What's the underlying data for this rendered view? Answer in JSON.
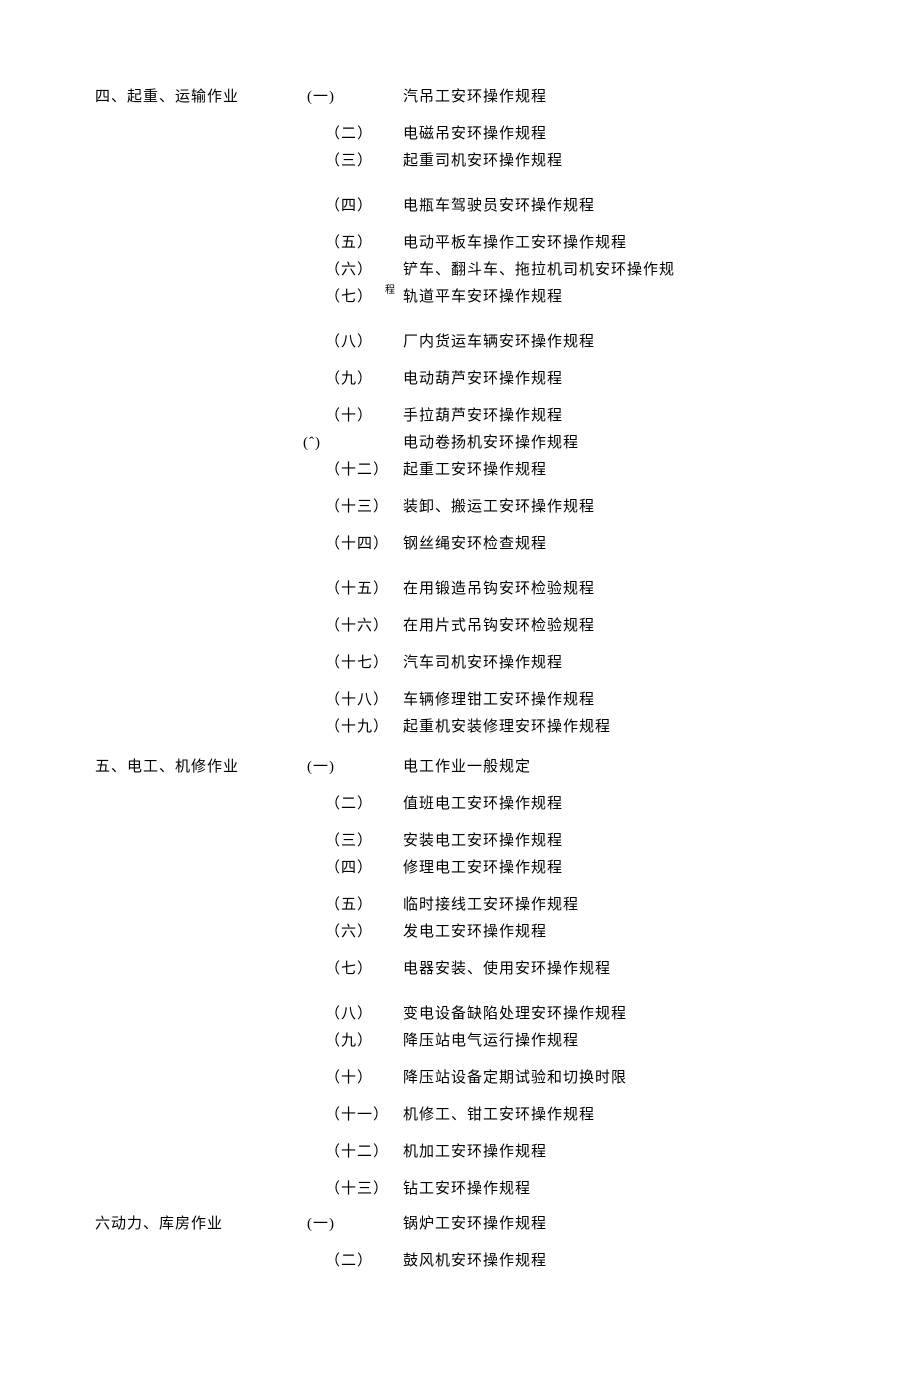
{
  "sections": [
    {
      "heading": "四、起重、运输作业",
      "items": [
        {
          "num": "(一)",
          "title": "汽吊工安环操作规程",
          "num_class": "shift-left",
          "gap": ""
        },
        {
          "num": "（二）",
          "title": "电磁吊安环操作规程",
          "gap": "gap-m"
        },
        {
          "num": "（三）",
          "title": "起重司机安环操作规程",
          "gap": "gap-s"
        },
        {
          "num": "（四）",
          "title": "电瓶车驾驶员安环操作规程",
          "gap": "gap-l"
        },
        {
          "num": "（五）",
          "title": "电动平板车操作工安环操作规程",
          "gap": "gap-m"
        },
        {
          "num": "（六）",
          "title": "铲车、翻斗车、拖拉机司机安环操作规",
          "gap": "gap-s"
        },
        {
          "num": "（七）",
          "title": "轨道平车安环操作规程",
          "gap": "gap-s",
          "note": "程"
        },
        {
          "num": "（八）",
          "title": "厂内货运车辆安环操作规程",
          "gap": "gap-l"
        },
        {
          "num": "（九）",
          "title": "电动葫芦安环操作规程",
          "gap": "gap-m"
        },
        {
          "num": "（十）",
          "title": "手拉葫芦安环操作规程",
          "gap": "gap-m"
        },
        {
          "num": "(ˆ)",
          "title": "电动卷扬机安环操作规程",
          "num_class": "xi-shift",
          "gap": "gap-s"
        },
        {
          "num": "（十二）",
          "title": "起重工安环操作规程",
          "gap": "gap-s"
        },
        {
          "num": "（十三）",
          "title": "装卸、搬运工安环操作规程",
          "gap": "gap-m"
        },
        {
          "num": "（十四）",
          "title": "钢丝绳安环检查规程",
          "gap": "gap-m"
        },
        {
          "num": "（十五）",
          "title": "在用锻造吊钩安环检验规程",
          "gap": "gap-l"
        },
        {
          "num": "（十六）",
          "title": "在用片式吊钩安环检验规程",
          "gap": "gap-m"
        },
        {
          "num": "（十七）",
          "title": "汽车司机安环操作规程",
          "gap": "gap-m"
        },
        {
          "num": "（十八）",
          "title": "车辆修理钳工安环操作规程",
          "gap": "gap-m"
        },
        {
          "num": "（十九）",
          "title": "起重机安装修理安环操作规程",
          "gap": "gap-s"
        }
      ]
    },
    {
      "heading": "五、电工、机修作业",
      "items": [
        {
          "num": "(一)",
          "title": "电工作业一般规定",
          "num_class": "shift-left",
          "gap": ""
        },
        {
          "num": "（二）",
          "title": "值班电工安环操作规程",
          "gap": "gap-m"
        },
        {
          "num": "（三）",
          "title": "安装电工安环操作规程",
          "gap": "gap-m"
        },
        {
          "num": "（四）",
          "title": "修理电工安环操作规程",
          "gap": "gap-s"
        },
        {
          "num": "（五）",
          "title": "临时接线工安环操作规程",
          "gap": "gap-m"
        },
        {
          "num": "（六）",
          "title": "发电工安环操作规程",
          "gap": "gap-s"
        },
        {
          "num": "（七）",
          "title": "电器安装、使用安环操作规程",
          "gap": "gap-m"
        },
        {
          "num": "（八）",
          "title": "变电设备缺陷处理安环操作规程",
          "gap": "gap-l"
        },
        {
          "num": "（九）",
          "title": "降压站电气运行操作规程",
          "gap": "gap-s"
        },
        {
          "num": "（十）",
          "title": "降压站设备定期试验和切换时限",
          "gap": "gap-m"
        },
        {
          "num": "（十一）",
          "title": "机修工、钳工安环操作规程",
          "gap": "gap-m"
        },
        {
          "num": "（十二）",
          "title": "机加工安环操作规程",
          "gap": "gap-m"
        },
        {
          "num": "（十三）",
          "title": "钻工安环操作规程",
          "gap": "gap-m"
        }
      ]
    },
    {
      "heading": "六动力、库房作业",
      "items": [
        {
          "num": "(一)",
          "title": "锅炉工安环操作规程",
          "num_class": "shift-left",
          "gap": ""
        },
        {
          "num": "（二）",
          "title": "鼓风机安环操作规程",
          "gap": "gap-m"
        }
      ]
    }
  ]
}
